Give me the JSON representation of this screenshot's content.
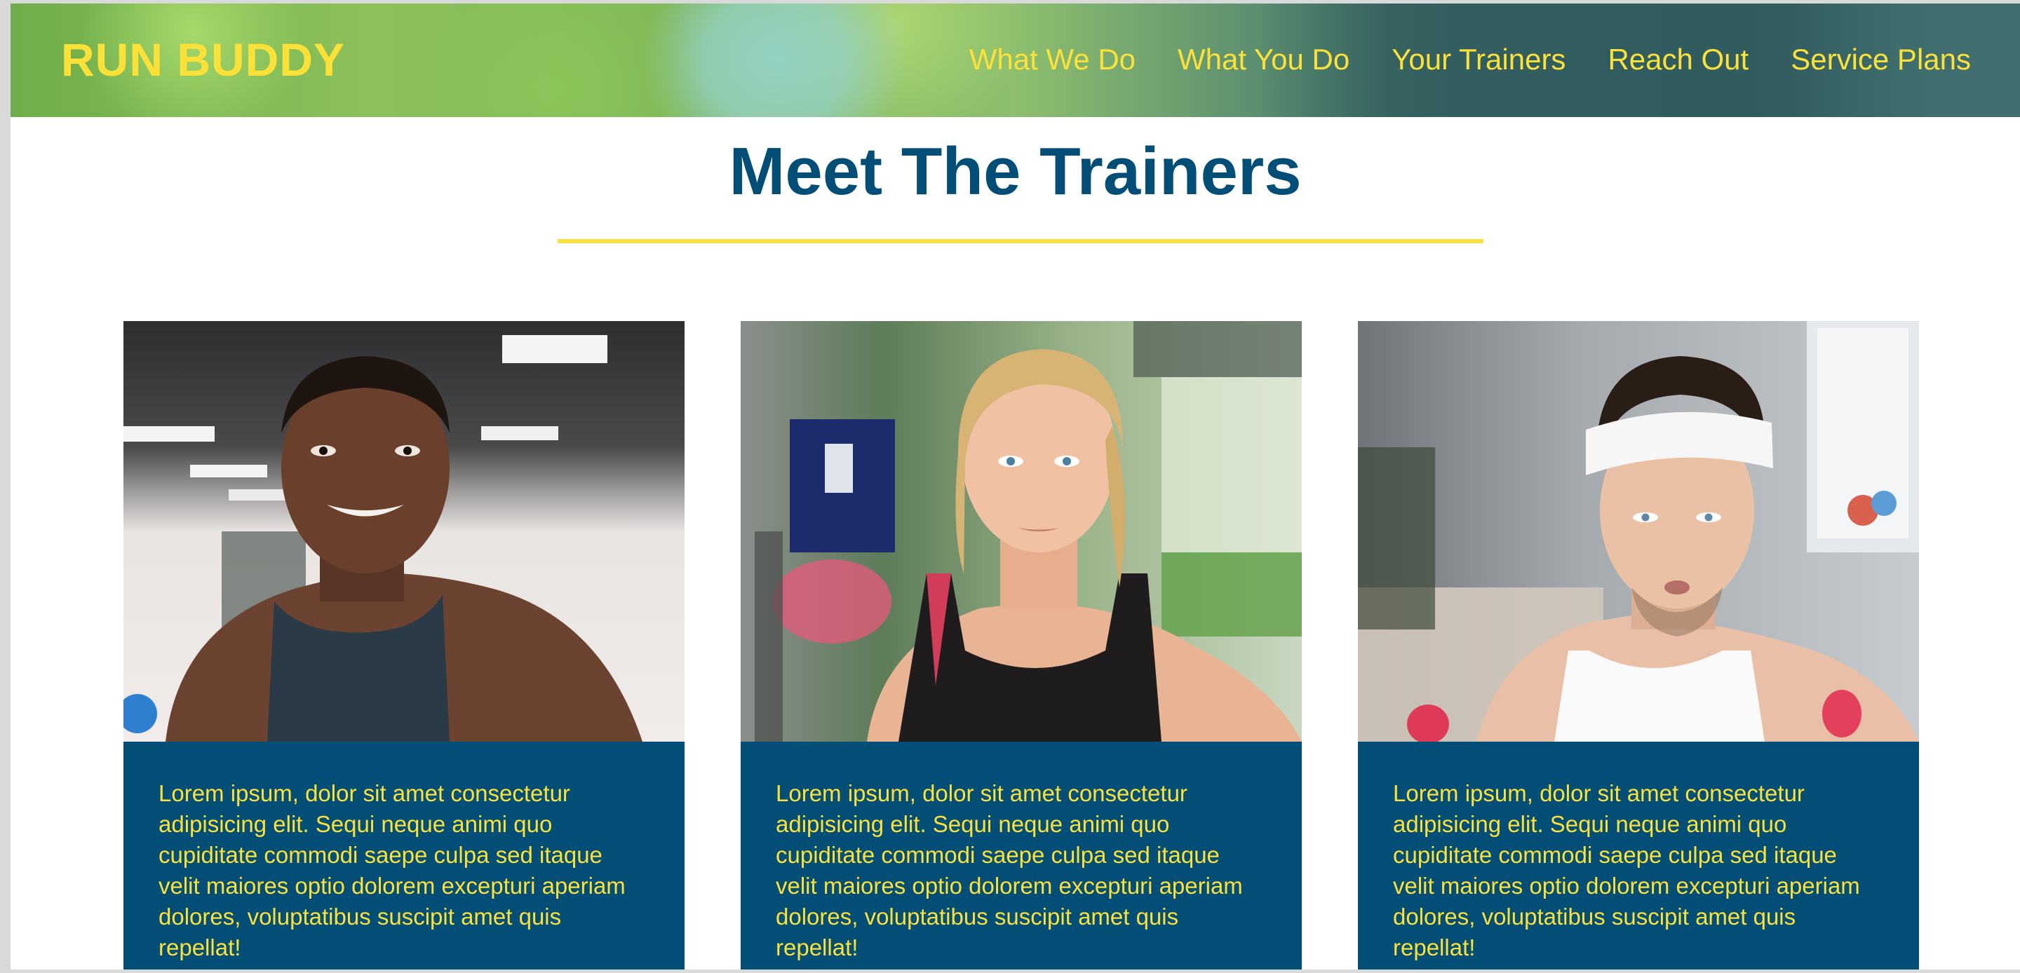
{
  "header": {
    "logo": "RUN BUDDY",
    "nav": [
      "What We Do",
      "What You Do",
      "Your Trainers",
      "Reach Out",
      "Service Plans"
    ]
  },
  "section": {
    "title": "Meet The Trainers"
  },
  "trainers": [
    {
      "photo_icon": "trainer-photo-1",
      "description": "Lorem ipsum, dolor sit amet consectetur adipisicing elit. Sequi neque animi quo cupiditate commodi saepe culpa sed itaque velit maiores optio dolorem excepturi aperiam dolores, voluptatibus suscipit amet quis repellat!"
    },
    {
      "photo_icon": "trainer-photo-2",
      "description": "Lorem ipsum, dolor sit amet consectetur adipisicing elit. Sequi neque animi quo cupiditate commodi saepe culpa sed itaque velit maiores optio dolorem excepturi aperiam dolores, voluptatibus suscipit amet quis repellat!"
    },
    {
      "photo_icon": "trainer-photo-3",
      "description": "Lorem ipsum, dolor sit amet consectetur adipisicing elit. Sequi neque animi quo cupiditate commodi saepe culpa sed itaque velit maiores optio dolorem excepturi aperiam dolores, voluptatibus suscipit amet quis repellat!"
    }
  ],
  "colors": {
    "brand_yellow": "#fce138",
    "brand_blue": "#024e76"
  }
}
